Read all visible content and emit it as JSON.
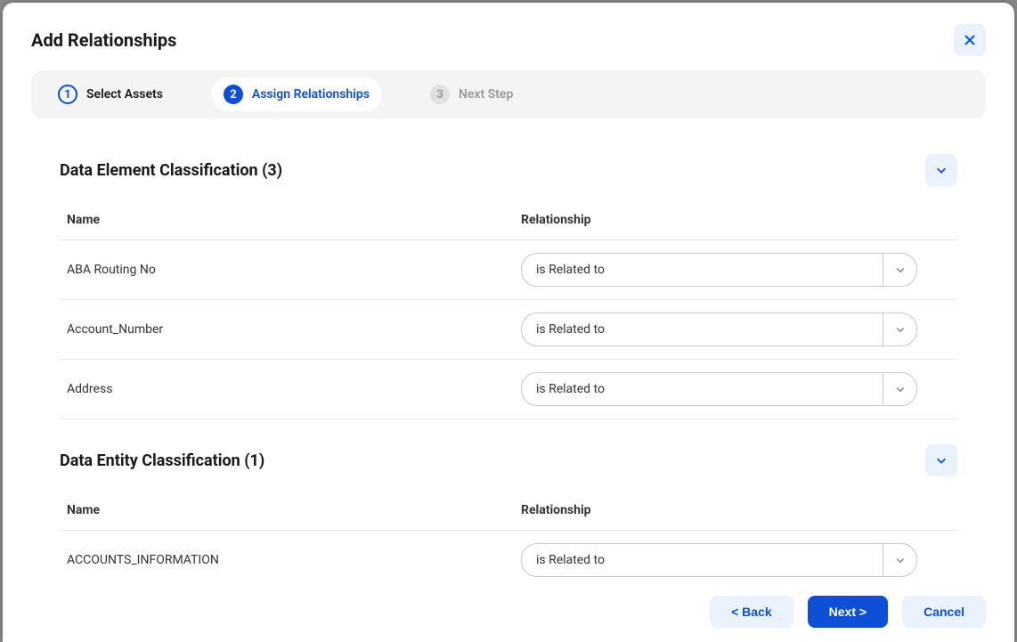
{
  "modal": {
    "title": "Add Relationships"
  },
  "stepper": {
    "steps": [
      {
        "num": "1",
        "label": "Select Assets"
      },
      {
        "num": "2",
        "label": "Assign Relationships"
      },
      {
        "num": "3",
        "label": "Next Step"
      }
    ]
  },
  "sections": [
    {
      "title": "Data Element Classification (3)",
      "headers": {
        "name": "Name",
        "rel": "Relationship"
      },
      "rows": [
        {
          "name": "ABA Routing No",
          "rel": "is Related to"
        },
        {
          "name": "Account_Number",
          "rel": "is Related to"
        },
        {
          "name": "Address",
          "rel": "is Related to"
        }
      ]
    },
    {
      "title": "Data Entity Classification (1)",
      "headers": {
        "name": "Name",
        "rel": "Relationship"
      },
      "rows": [
        {
          "name": "ACCOUNTS_INFORMATION",
          "rel": "is Related to"
        }
      ]
    }
  ],
  "footer": {
    "back": "< Back",
    "next": "Next >",
    "cancel": "Cancel"
  }
}
